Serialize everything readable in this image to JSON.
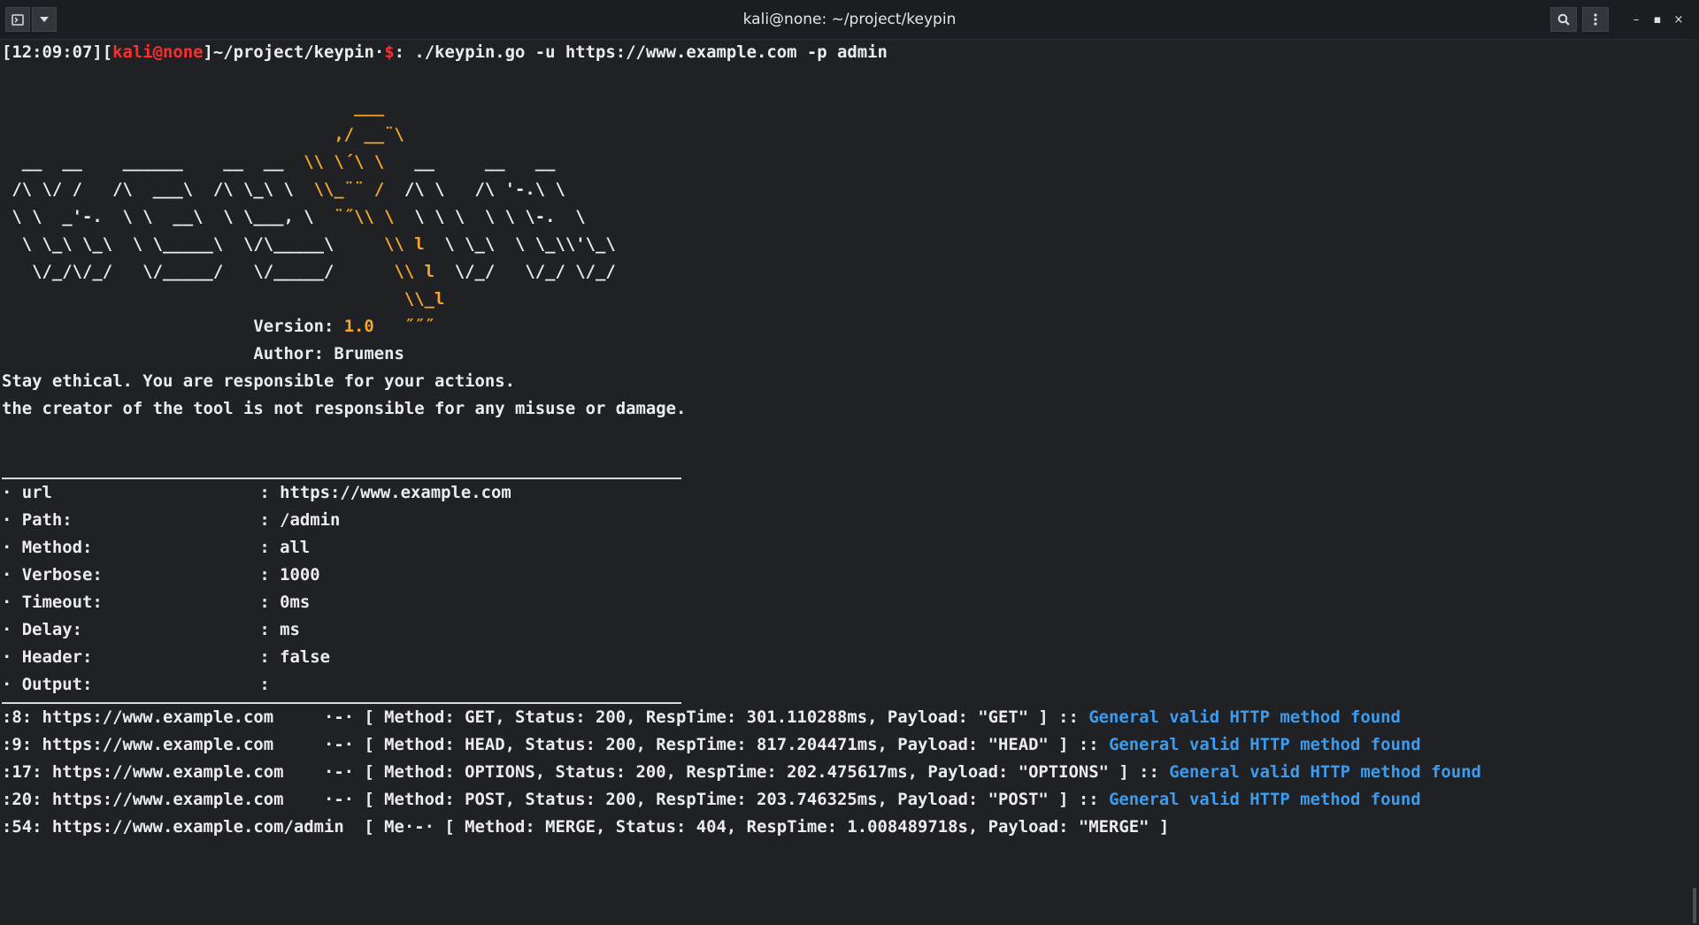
{
  "window": {
    "title": "kali@none: ~/project/keypin",
    "buttons": {
      "new_tab_icon": "terminal-icon",
      "menu_icon": "chevron-down-icon",
      "search_icon": "search-icon",
      "more_icon": "more-vertical-icon"
    },
    "controls": {
      "minimize": "–",
      "maximize": "▪",
      "close": "×"
    }
  },
  "prompt": {
    "time": "[12:09:07]",
    "open": "[",
    "user": "kali@none",
    "close": "]",
    "path": "~/project/keypin",
    "dot": "·",
    "dollar": "$",
    "colon": ":",
    "command": " ./keypin.go -u https://www.example.com -p admin"
  },
  "banner": {
    "art": [
      {
        "white": "",
        "orange": "                                   ___"
      },
      {
        "white": "",
        "orange": "                                 ,/ __¨\\"
      },
      {
        "white": "  __  __    ______    __  __ ",
        "orange": " \\\\ \\´\\ \\",
        "white2": "   __     __   __"
      },
      {
        "white": " /\\ \\/ /   /\\  ___\\  /\\ \\_\\ \\ ",
        "orange": " \\\\_¨¨ /",
        "white2": "  /\\ \\   /\\ '-.\\ \\"
      },
      {
        "white": " \\ \\  _'-.  \\ \\  __\\  \\ \\___, \\ ",
        "orange": " ¨˝\\\\ \\",
        "white2": "  \\ \\ \\  \\ \\ \\-.  \\"
      },
      {
        "white": "  \\ \\_\\ \\_\\  \\ \\_____\\  \\/\\_____\\ ",
        "orange": "    \\\\ l",
        "white2": "  \\ \\_\\  \\ \\_\\\\'\\_\\"
      },
      {
        "white": "   \\/_/\\/_/   \\/_____/   \\/_____/  ",
        "orange": "    \\\\ l",
        "white2": "  \\/_/   \\/_/ \\/_/"
      },
      {
        "white": "",
        "orange": "                                        \\\\_l"
      }
    ],
    "version_label": "                         Version: ",
    "version_value": "1.0",
    "version_trail": "   ˝˝˝",
    "author": "                         Author: Brumens",
    "warning1": "Stay ethical. You are responsible for your actions.",
    "warning2": "the creator of the tool is not responsible for any misuse or damage."
  },
  "config": [
    {
      "bullet": "·",
      "key": " url",
      "value": ": https://www.example.com"
    },
    {
      "bullet": "·",
      "key": " Path:",
      "value": ": /admin"
    },
    {
      "bullet": "·",
      "key": " Method:",
      "value": ": all"
    },
    {
      "bullet": "·",
      "key": " Verbose:",
      "value": ": 1000"
    },
    {
      "bullet": "·",
      "key": " Timeout:",
      "value": ": 0ms"
    },
    {
      "bullet": "·",
      "key": " Delay:",
      "value": ": ms"
    },
    {
      "bullet": "·",
      "key": " Header:",
      "value": ": false"
    },
    {
      "bullet": "·",
      "key": " Output:",
      "value": ":"
    }
  ],
  "results": [
    {
      "prefix": ":8: https://www.example.com     ·-· ",
      "body": "[ Method: GET, Status: 200, RespTime: 301.110288ms, Payload: \"GET\" ] :: ",
      "note": "General valid HTTP method found"
    },
    {
      "prefix": ":9: https://www.example.com     ·-· ",
      "body": "[ Method: HEAD, Status: 200, RespTime: 817.204471ms, Payload: \"HEAD\" ] :: ",
      "note": "General valid HTTP method found"
    },
    {
      "prefix": ":17: https://www.example.com    ·-· ",
      "body": "[ Method: OPTIONS, Status: 200, RespTime: 202.475617ms, Payload: \"OPTIONS\" ] :: ",
      "note": "General valid HTTP method found"
    },
    {
      "prefix": ":20: https://www.example.com    ·-· ",
      "body": "[ Method: POST, Status: 200, RespTime: 203.746325ms, Payload: \"POST\" ] :: ",
      "note": "General valid HTTP method found"
    },
    {
      "prefix": ":54: https://www.example.com/admin  [ Me·-· ",
      "body": "[ Method: MERGE, Status: 404, RespTime: 1.008489718s, Payload: \"MERGE\" ]",
      "note": ""
    }
  ],
  "colors": {
    "background": "#1f2124",
    "prompt_user": "#ff2d2d",
    "ascii_accent": "#f5a62b",
    "found_note": "#3b9cf0"
  }
}
